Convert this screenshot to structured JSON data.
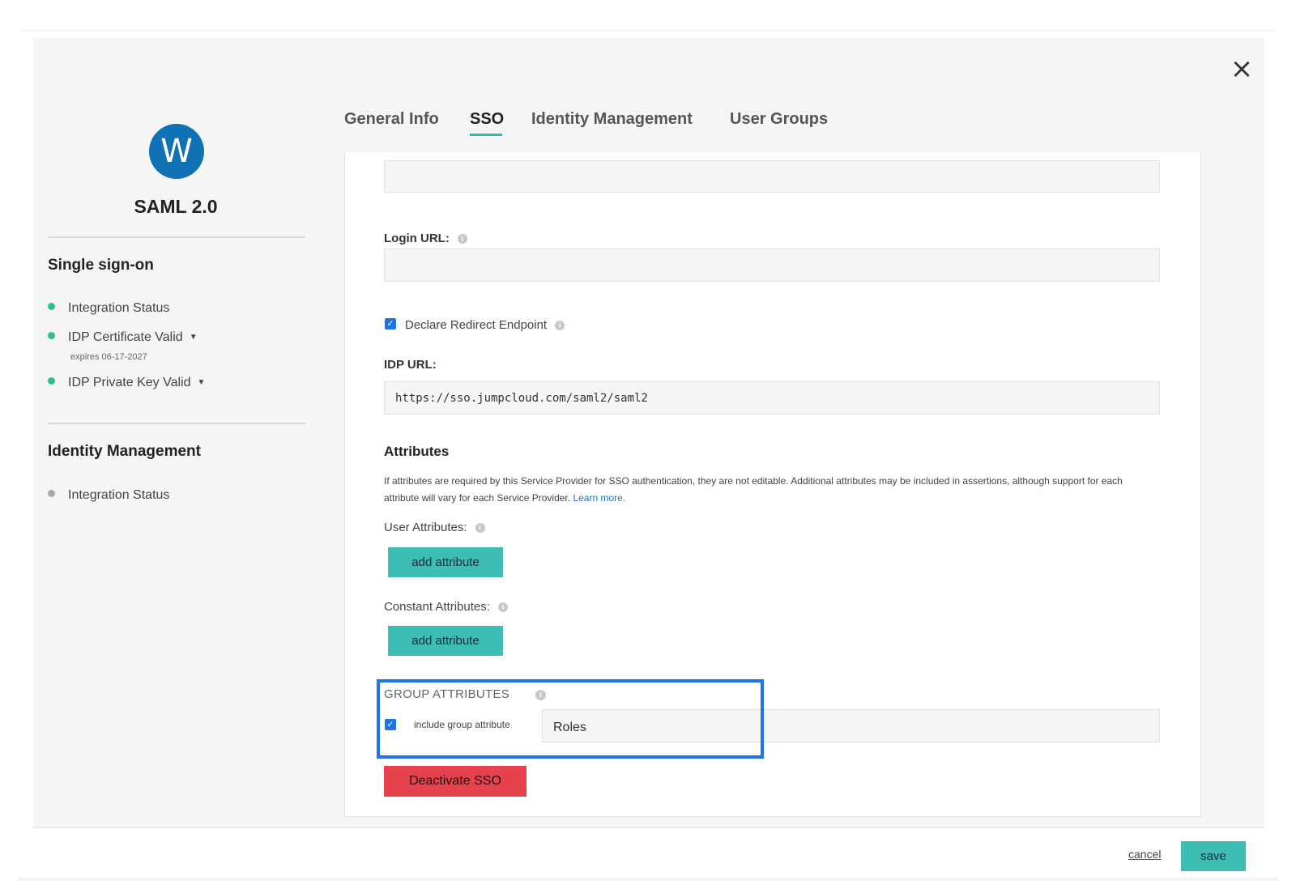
{
  "modal": {
    "app_initial": "W",
    "app_name": "SAML 2.0",
    "close_icon": "×"
  },
  "sidebar": {
    "single_sign_on_title": "Single sign-on",
    "sso_status": [
      {
        "label": "Integration Status",
        "color": "#2fbf8f"
      },
      {
        "label": "IDP Certificate Valid",
        "color": "#2fbf8f",
        "note": "expires 06-17-2027"
      },
      {
        "label": "IDP Private Key Valid",
        "color": "#2fbf8f"
      }
    ],
    "identity_management_title": "Identity Management",
    "im_status": [
      {
        "label": "Integration Status",
        "color": "#a8a8a8"
      }
    ]
  },
  "tabs": [
    {
      "label": "General Info"
    },
    {
      "label": "SSO",
      "active": true
    },
    {
      "label": "Identity Management"
    },
    {
      "label": "User Groups"
    }
  ],
  "form": {
    "login_url_label": "Login URL:",
    "login_url_value": "",
    "declare_redirect_label": "Declare Redirect Endpoint",
    "declare_redirect_checked": true,
    "idp_url_label": "IDP URL:",
    "idp_url_value": "https://sso.jumpcloud.com/saml2/saml2",
    "attributes_title": "Attributes",
    "attributes_desc": "If attributes are required by this Service Provider for SSO authentication, they are not editable. Additional attributes may be included in assertions, although support for each attribute will vary for each Service Provider.",
    "learn_more": "Learn more.",
    "user_attributes_label": "User Attributes:",
    "constant_attributes_label": "Constant Attributes:",
    "add_attribute_label": "add attribute",
    "group_attributes_label": "GROUP ATTRIBUTES",
    "include_group_label": "include group attribute",
    "include_group_checked": true,
    "group_attribute_value": "Roles",
    "deactivate_label": "Deactivate SSO"
  },
  "footer": {
    "cancel_label": "cancel",
    "save_label": "save"
  },
  "colors": {
    "accent": "#3dbdb3",
    "danger": "#e5424d",
    "brand": "#1172b3",
    "highlight": "#1f73e8"
  }
}
